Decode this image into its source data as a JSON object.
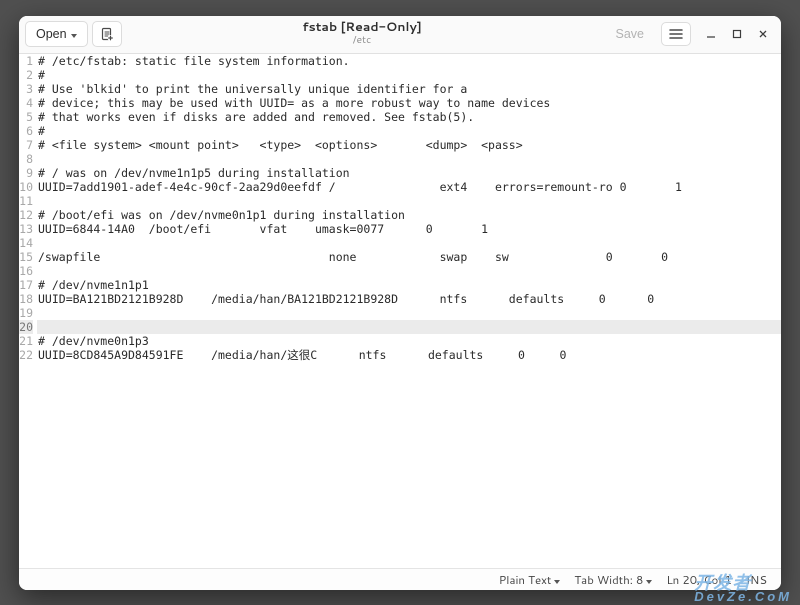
{
  "header": {
    "open_label": "Open",
    "title": "fstab [Read-Only]",
    "subtitle": "/etc",
    "save_label": "Save"
  },
  "file": {
    "lines": [
      "# /etc/fstab: static file system information.",
      "#",
      "# Use 'blkid' to print the universally unique identifier for a",
      "# device; this may be used with UUID= as a more robust way to name devices",
      "# that works even if disks are added and removed. See fstab(5).",
      "#",
      "# <file system> <mount point>   <type>  <options>       <dump>  <pass>",
      "",
      "# / was on /dev/nvme1n1p5 during installation",
      "UUID=7add1901-adef-4e4c-90cf-2aa29d0eefdf /               ext4    errors=remount-ro 0       1",
      "",
      "# /boot/efi was on /dev/nvme0n1p1 during installation",
      "UUID=6844-14A0  /boot/efi       vfat    umask=0077      0       1",
      "",
      "/swapfile                                 none            swap    sw              0       0",
      "",
      "# /dev/nvme1n1p1",
      "UUID=BA121BD2121B928D    /media/han/BA121BD2121B928D      ntfs      defaults     0      0",
      "",
      "",
      "# /dev/nvme0n1p3",
      "UUID=8CD845A9D84591FE    /media/han/这很C      ntfs      defaults     0     0"
    ],
    "current_line_index": 19
  },
  "status": {
    "syntax": "Plain Text",
    "tab_width_label": "Tab Width:",
    "tab_width_value": "8",
    "position": "Ln 20, Col 1",
    "insert_mode": "INS"
  },
  "watermark": {
    "line1": "开发者",
    "line2": "DevZe.CoM"
  }
}
